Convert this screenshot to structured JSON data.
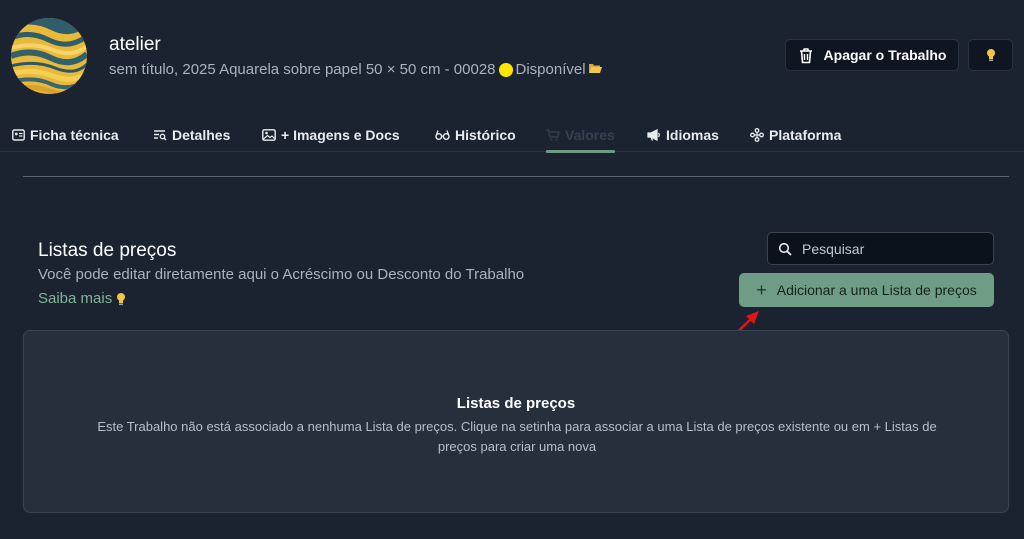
{
  "header": {
    "title": "atelier",
    "subtitle": "sem título, 2025 Aquarela sobre papel 50 × 50 cm - 00028",
    "status": "Disponível",
    "status_color": "#ffe600",
    "delete_label": "Apagar o Trabalho",
    "delete_icon": "trash-icon",
    "idea_icon": "lightbulb-icon"
  },
  "tabs": [
    {
      "label": "Ficha técnica",
      "icon": "id-card-icon"
    },
    {
      "label": "Detalhes",
      "icon": "details-list-icon"
    },
    {
      "label": "+ Imagens e Docs",
      "icon": "image-icon"
    },
    {
      "label": "Histórico",
      "icon": "glasses-icon"
    },
    {
      "label": "Valores",
      "icon": "cart-icon",
      "active": true
    },
    {
      "label": "Idiomas",
      "icon": "megaphone-icon"
    },
    {
      "label": "Plataforma",
      "icon": "platform-icon"
    }
  ],
  "section": {
    "title": "Listas de preços",
    "description": "Você pode editar diretamente aqui o Acréscimo ou Desconto do Trabalho",
    "learn_more": "Saiba mais"
  },
  "search": {
    "placeholder": "Pesquisar",
    "value": ""
  },
  "add_button": {
    "label": "Adicionar a uma Lista de preços"
  },
  "empty_state": {
    "title": "Listas de preços",
    "text": "Este Trabalho não está associado a nenhuma Lista de preços. Clique na setinha para associar a uma Lista de preços existente ou em + Listas de preços para criar uma nova"
  },
  "colors": {
    "background": "#1b2331",
    "accent": "#6f9c85",
    "annotation_arrow": "#e0151b"
  }
}
